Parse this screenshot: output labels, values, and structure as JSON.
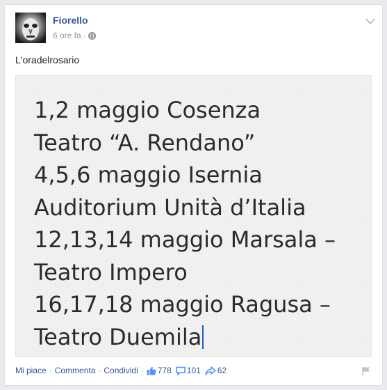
{
  "post": {
    "author": "Fiorello",
    "time": "6 ore fa",
    "meta_separator": "·",
    "text": "L'oradelrosario",
    "photo_lines": [
      "1,2 maggio Cosenza",
      "Teatro “A. Rendano”",
      "4,5,6 maggio Isernia",
      "Auditorium Unità d’Italia",
      "12,13,14 maggio Marsala –",
      "Teatro Impero",
      "16,17,18 maggio Ragusa –",
      "Teatro Duemila"
    ]
  },
  "actions": {
    "like": "Mi piace",
    "comment": "Commenta",
    "share": "Condividi",
    "separator": "·"
  },
  "stats": {
    "likes": "778",
    "comments": "101",
    "shares": "62"
  },
  "icons": {
    "privacy": "globe-icon",
    "options": "chevron-down-icon",
    "like": "thumbs-up-icon",
    "comment": "comment-bubble-icon",
    "share": "share-arrow-icon",
    "report": "flag-icon"
  },
  "colors": {
    "link": "#365899",
    "meta": "#90949c",
    "text": "#1d2129",
    "cursor": "#1e5ec8"
  }
}
